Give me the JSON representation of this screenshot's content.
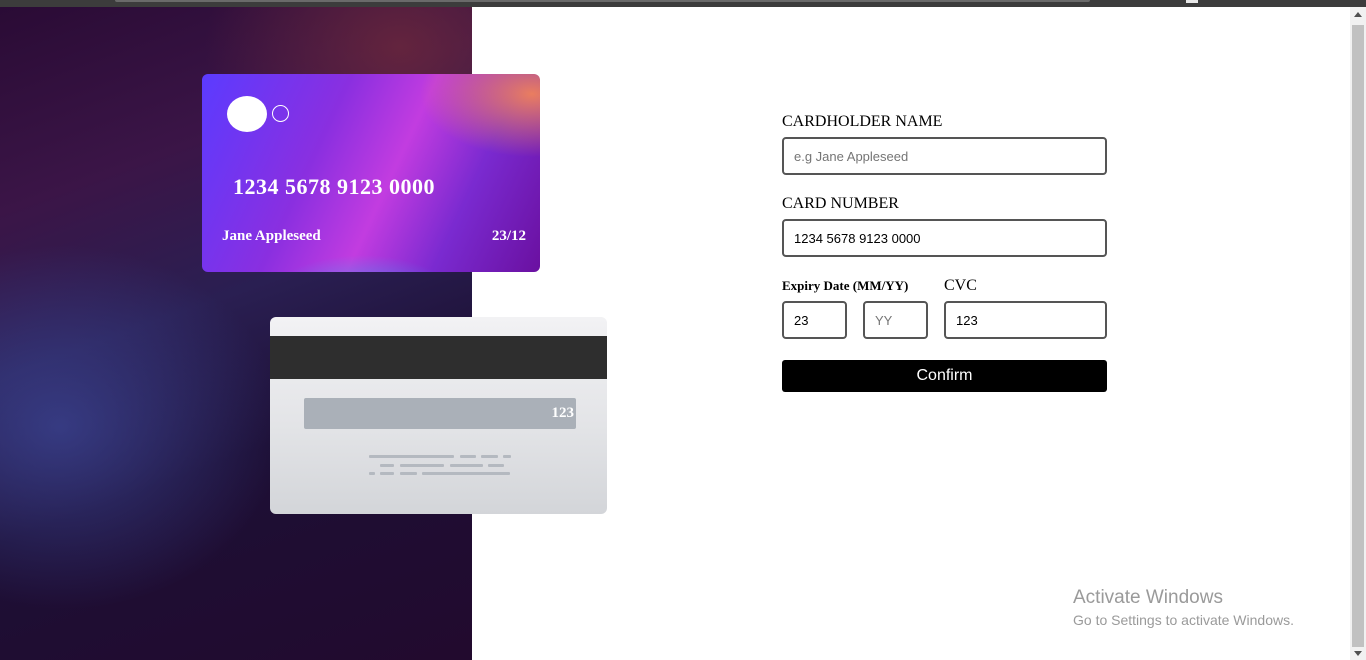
{
  "card_front": {
    "number": "1234 5678 9123 0000",
    "name": "Jane Appleseed",
    "expiry": "23/12"
  },
  "card_back": {
    "cvc": "123"
  },
  "form": {
    "name_label": "CARDHOLDER NAME",
    "name_placeholder": "e.g Jane Appleseed",
    "name_value": "",
    "number_label": "CARD NUMBER",
    "number_value": "1234 5678 9123 0000",
    "expiry_label": "Expiry Date (MM/YY)",
    "mm_value": "23",
    "yy_placeholder": "YY",
    "yy_value": "",
    "cvc_label": "CVC",
    "cvc_value": "123",
    "confirm_label": "Confirm"
  },
  "watermark": {
    "title": "Activate Windows",
    "subtitle": "Go to Settings to activate Windows."
  }
}
